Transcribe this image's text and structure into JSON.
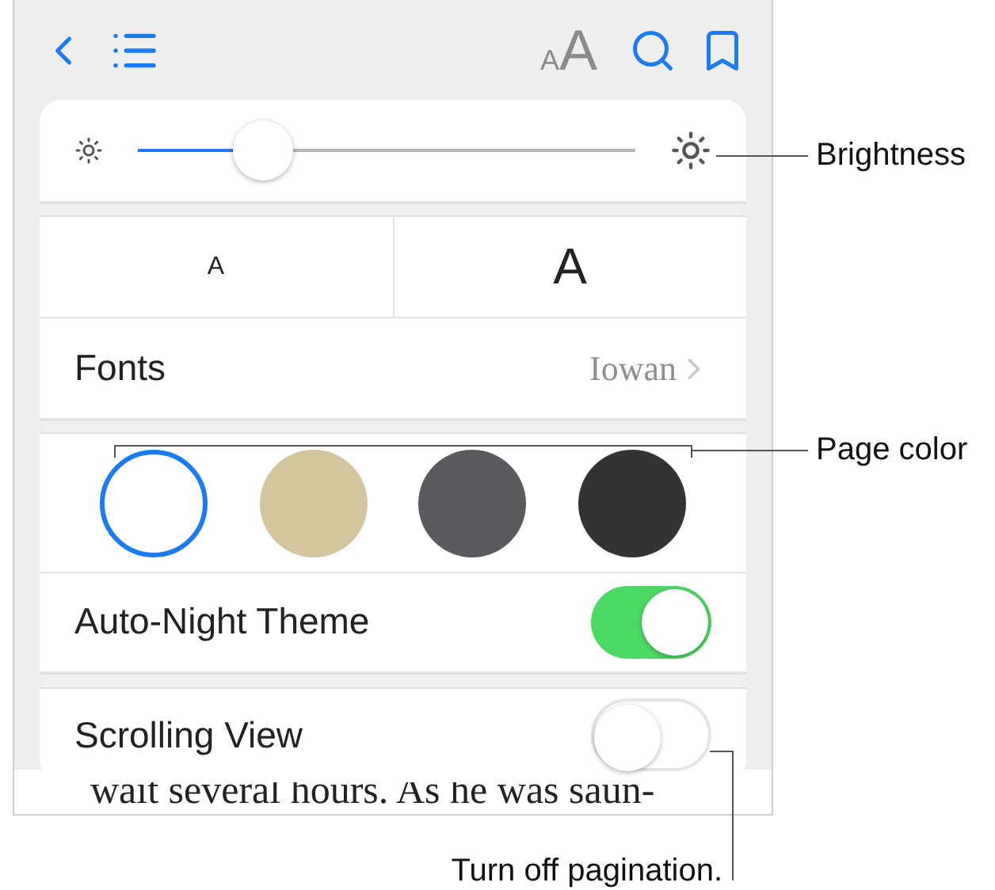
{
  "toolbar": {
    "font_small": "A",
    "font_large": "A"
  },
  "brightness": {
    "level": 0.25
  },
  "font_size": {
    "smaller": "A",
    "larger": "A"
  },
  "fonts": {
    "label": "Fonts",
    "value": "Iowan"
  },
  "page_colors": [
    {
      "color": "#ffffff",
      "selected": true
    },
    {
      "color": "#d3c59c",
      "selected": false
    },
    {
      "color": "#5a5a5e",
      "selected": false
    },
    {
      "color": "#333333",
      "selected": false
    }
  ],
  "toggles": [
    {
      "label": "Auto-Night Theme",
      "on": true
    },
    {
      "label": "Scrolling View",
      "on": false
    }
  ],
  "book_text": "wait several hours. As he was saun-",
  "callouts": [
    {
      "kind": "brightness",
      "text": "Brightness"
    },
    {
      "kind": "page-color",
      "text": "Page color"
    },
    {
      "kind": "pagination",
      "text": "Turn off pagination."
    }
  ]
}
